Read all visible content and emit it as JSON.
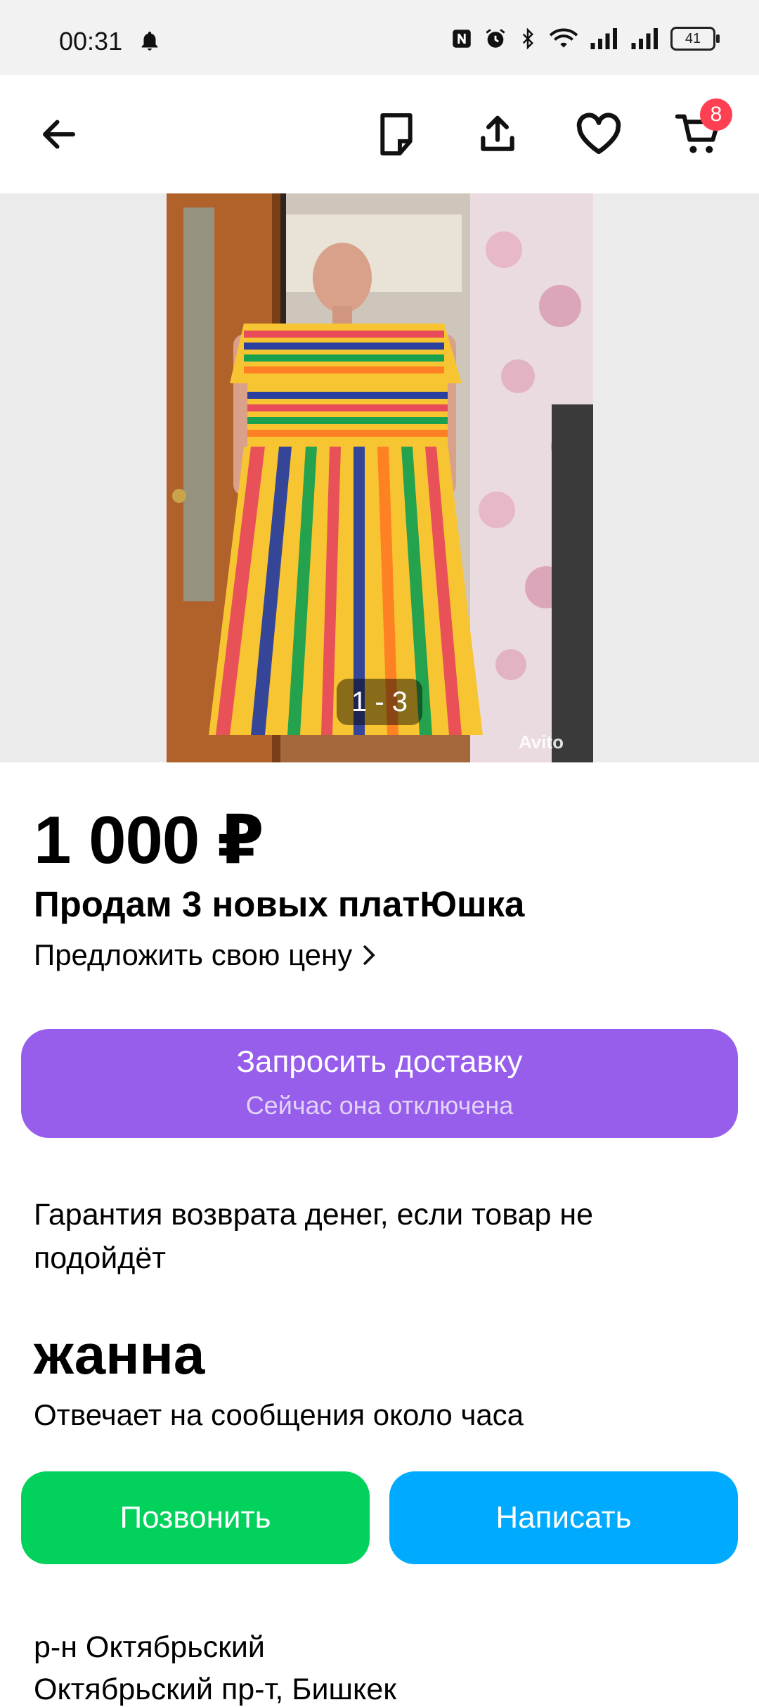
{
  "status_bar": {
    "time": "00:31",
    "battery": "41"
  },
  "top_bar": {
    "cart_badge": "8"
  },
  "gallery": {
    "counter": "1 - 3",
    "watermark": "Avito"
  },
  "listing": {
    "price": "1 000 ₽",
    "title": "Продам 3 новых платЮшка",
    "offer_price": "Предложить свою цену"
  },
  "delivery": {
    "label": "Запросить доставку",
    "sublabel": "Сейчас она отключена",
    "color": "#965eeb"
  },
  "guarantee": "Гарантия возврата денег, если товар не подойдёт",
  "seller": {
    "name": "жанна",
    "response_time": "Отвечает на сообщения около часа"
  },
  "actions": {
    "call": "Позвонить",
    "call_color": "#02d15c",
    "write": "Написать",
    "write_color": "#00aaff"
  },
  "location": {
    "district": "р-н Октябрьский",
    "address_partial": "Октябрьский пр-т, Бишкек"
  }
}
